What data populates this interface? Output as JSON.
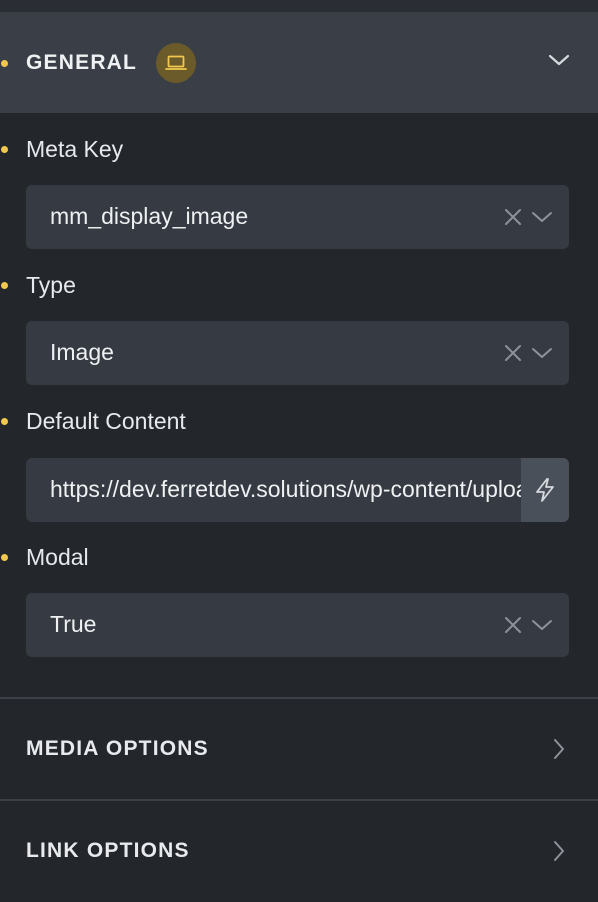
{
  "sections": {
    "general": {
      "title": "GENERAL",
      "badge_icon": "laptop-icon",
      "expanded": true
    },
    "media_options": {
      "title": "MEDIA OPTIONS"
    },
    "link_options": {
      "title": "LINK OPTIONS"
    }
  },
  "fields": {
    "meta_key": {
      "label": "Meta Key",
      "value": "mm_display_image"
    },
    "type": {
      "label": "Type",
      "value": "Image"
    },
    "default_content": {
      "label": "Default Content",
      "value": "https://dev.ferretdev.solutions/wp-content/uploads/"
    },
    "modal": {
      "label": "Modal",
      "value": "True"
    }
  },
  "colors": {
    "indicator_dot": "#f2c94c",
    "badge_bg": "#6b5a2a",
    "panel_bg": "#23262b",
    "header_bg": "#3a3f47",
    "input_bg": "#363a42"
  }
}
